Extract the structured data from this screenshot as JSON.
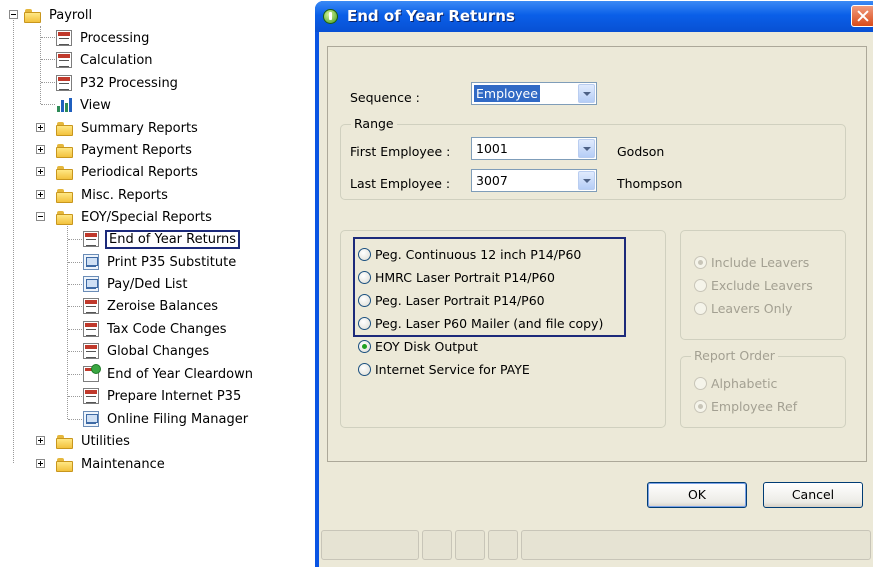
{
  "tree": {
    "root": "Payroll",
    "items": [
      {
        "label": "Processing",
        "icon": "report-icon"
      },
      {
        "label": "Calculation",
        "icon": "report-icon"
      },
      {
        "label": "P32 Processing",
        "icon": "report-icon"
      },
      {
        "label": "View",
        "icon": "bar-chart-icon"
      },
      {
        "label": "Summary Reports",
        "icon": "folder-icon"
      },
      {
        "label": "Payment Reports",
        "icon": "folder-icon"
      },
      {
        "label": "Periodical Reports",
        "icon": "folder-icon"
      },
      {
        "label": "Misc. Reports",
        "icon": "folder-icon"
      },
      {
        "label": "EOY/Special Reports",
        "icon": "folder-icon"
      }
    ],
    "eoy_items": [
      {
        "label": "End of Year Returns",
        "icon": "report-icon"
      },
      {
        "label": "Print P35 Substitute",
        "icon": "preview-icon"
      },
      {
        "label": "Pay/Ded List",
        "icon": "preview-icon"
      },
      {
        "label": "Zeroise Balances",
        "icon": "report-icon"
      },
      {
        "label": "Tax Code Changes",
        "icon": "report-icon"
      },
      {
        "label": "Global Changes",
        "icon": "report-icon"
      },
      {
        "label": "End of Year Cleardown",
        "icon": "cleardown-icon"
      },
      {
        "label": "Prepare Internet P35",
        "icon": "report-icon"
      },
      {
        "label": "Online Filing Manager",
        "icon": "preview-icon"
      }
    ],
    "tail_items": [
      {
        "label": "Utilities",
        "icon": "folder-icon"
      },
      {
        "label": "Maintenance",
        "icon": "folder-icon"
      }
    ]
  },
  "dialog": {
    "title": "End of Year Returns",
    "sequence_label": "Sequence :",
    "sequence_value": "Employee",
    "range_legend": "Range",
    "first_employee_label": "First Employee :",
    "first_employee_value": "1001",
    "first_employee_name": "Godson",
    "last_employee_label": "Last Employee :",
    "last_employee_value": "3007",
    "last_employee_name": "Thompson",
    "output_options": [
      {
        "label": "Peg. Continuous 12 inch P14/P60",
        "checked": false
      },
      {
        "label": "HMRC Laser Portrait P14/P60",
        "checked": false
      },
      {
        "label": "Peg. Laser Portrait P14/P60",
        "checked": false
      },
      {
        "label": "Peg. Laser P60 Mailer (and file copy)",
        "checked": false
      },
      {
        "label": "EOY Disk Output",
        "checked": true
      },
      {
        "label": "Internet Service for PAYE",
        "checked": false
      }
    ],
    "leavers_options": [
      {
        "label": "Include Leavers",
        "checked": true
      },
      {
        "label": "Exclude Leavers",
        "checked": false
      },
      {
        "label": "Leavers Only",
        "checked": false
      }
    ],
    "report_order_legend": "Report Order",
    "report_order_options": [
      {
        "label": "Alphabetic",
        "checked": false
      },
      {
        "label": "Employee Ref",
        "checked": true
      }
    ],
    "ok_label": "OK",
    "cancel_label": "Cancel"
  },
  "colors": {
    "title_bar": "#0a5fe8",
    "dialog_face": "#ece9d8",
    "selection_box": "#1c2a7a",
    "combo_highlight": "#316ac5"
  }
}
